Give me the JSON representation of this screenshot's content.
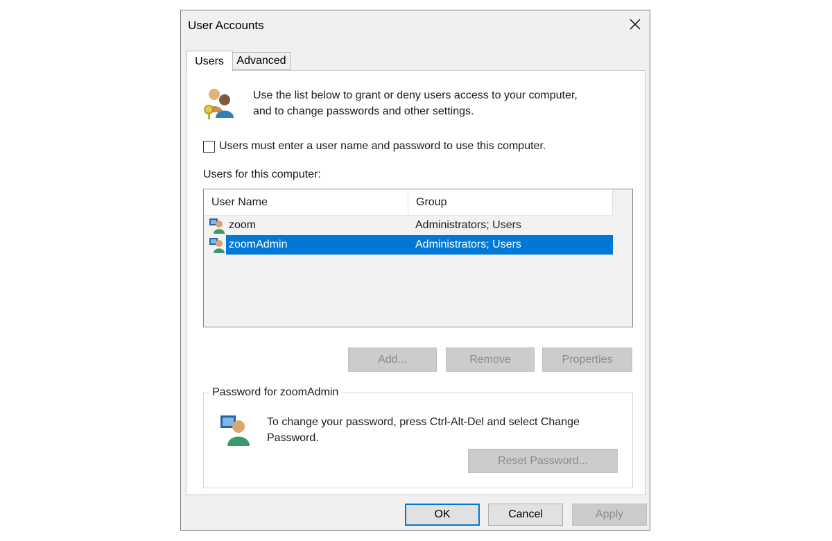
{
  "window": {
    "title": "User Accounts",
    "close_icon": "close-icon"
  },
  "tabs": [
    {
      "label": "Users",
      "selected": true
    },
    {
      "label": "Advanced",
      "selected": false
    }
  ],
  "users_tab": {
    "intro_line1": "Use the list below to grant or deny users access to your computer,",
    "intro_line2": "and to change passwords and other settings.",
    "require_password_checkbox": {
      "label": "Users must enter a user name and password to use this computer.",
      "checked": false
    },
    "list_label": "Users for this computer:",
    "columns": [
      "User Name",
      "Group"
    ],
    "users": [
      {
        "name": "zoom",
        "group": "Administrators; Users",
        "selected": false
      },
      {
        "name": "zoomAdmin",
        "group": "Administrators; Users",
        "selected": true
      }
    ],
    "buttons": {
      "add": "Add...",
      "remove": "Remove",
      "properties": "Properties"
    },
    "password_group": {
      "title": "Password for zoomAdmin",
      "text_line1": "To change your password, press Ctrl-Alt-Del and select Change",
      "text_line2": "Password.",
      "reset_button": "Reset Password..."
    }
  },
  "footer": {
    "ok": "OK",
    "cancel": "Cancel",
    "apply": "Apply"
  },
  "colors": {
    "selection": "#0078d7",
    "dialog_bg": "#f0f0f0"
  }
}
